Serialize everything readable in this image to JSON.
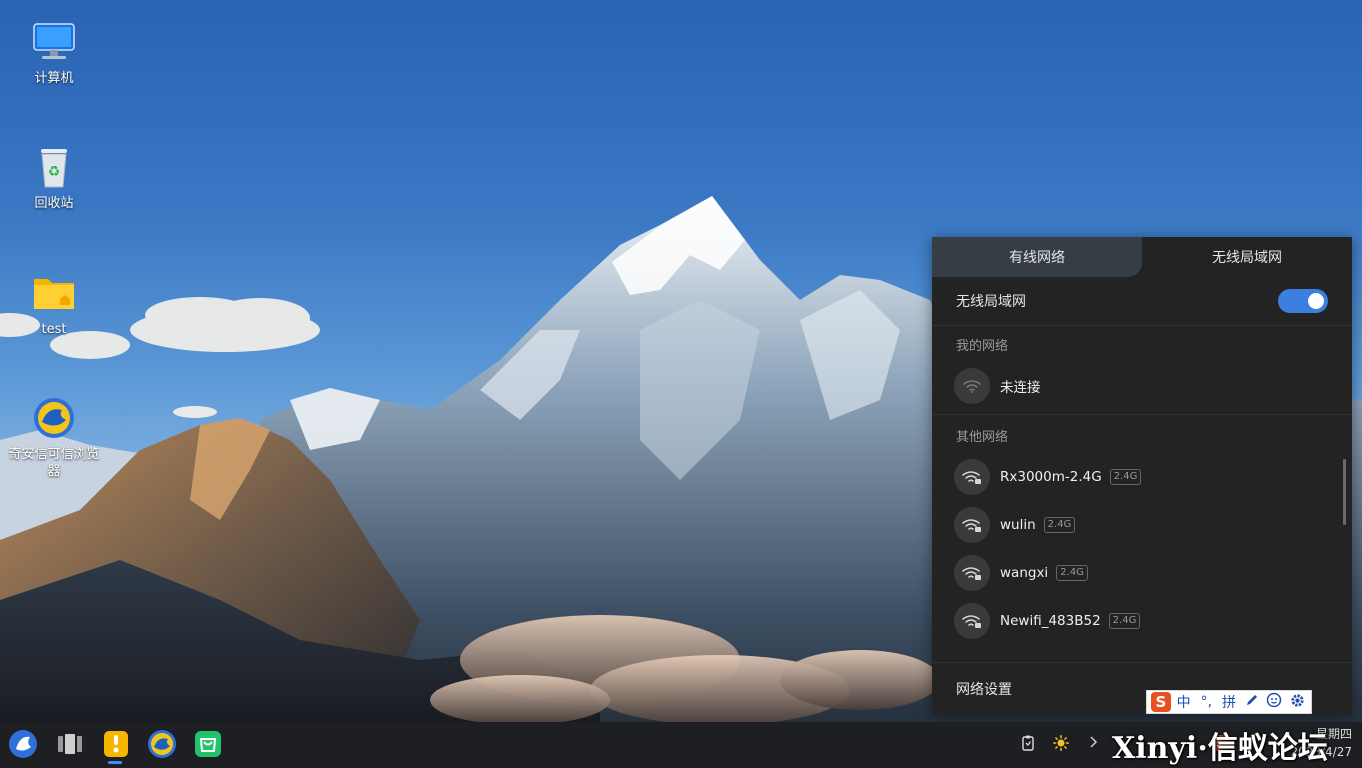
{
  "desktop": {
    "icons": [
      {
        "label": "计算机",
        "icon": "computer-icon"
      },
      {
        "label": "回收站",
        "icon": "recycle-bin-icon"
      },
      {
        "label": "test",
        "icon": "folder-icon"
      },
      {
        "label": "奇安信可信浏览器",
        "icon": "browser-icon"
      }
    ]
  },
  "network_panel": {
    "tabs": [
      {
        "label": "有线网络",
        "active": false
      },
      {
        "label": "无线局域网",
        "active": true
      }
    ],
    "wifi_toggle": {
      "label": "无线局域网",
      "on": true
    },
    "my_networks": {
      "label": "我的网络",
      "items": [
        {
          "name": "未连接",
          "icon": "wifi-icon"
        }
      ]
    },
    "other_networks": {
      "label": "其他网络",
      "items": [
        {
          "name": "Rx3000m-2.4G",
          "band": "2.4G",
          "icon": "wifi-lock-icon"
        },
        {
          "name": "wulin",
          "band": "2.4G",
          "icon": "wifi-lock-icon"
        },
        {
          "name": "wangxi",
          "band": "2.4G",
          "icon": "wifi-lock-icon"
        },
        {
          "name": "Newifi_483B52",
          "band": "2.4G",
          "icon": "wifi-lock-icon"
        }
      ]
    },
    "settings_label": "网络设置"
  },
  "ime_bar": {
    "logo": "S",
    "items": [
      "中",
      "°,",
      "拼",
      "pen-icon",
      "face-icon",
      "gear-icon"
    ]
  },
  "taskbar": {
    "apps": [
      "start-menu-icon",
      "multitask-view-icon",
      "file-manager-icon",
      "browser-icon",
      "app-store-icon"
    ],
    "tray": [
      "clipboard-icon",
      "brightness-icon",
      "chevron-right-icon",
      "ime-icon"
    ],
    "clock_weekday": "星期四",
    "clock_date": "2023/4/27"
  },
  "watermark": "Xinyi·信蚁论坛",
  "colors": {
    "panel_bg": "#232323",
    "tab_inactive": "#363d44",
    "toggle_on": "#3d7fe0",
    "taskbar_bg": "#1d1f22"
  }
}
